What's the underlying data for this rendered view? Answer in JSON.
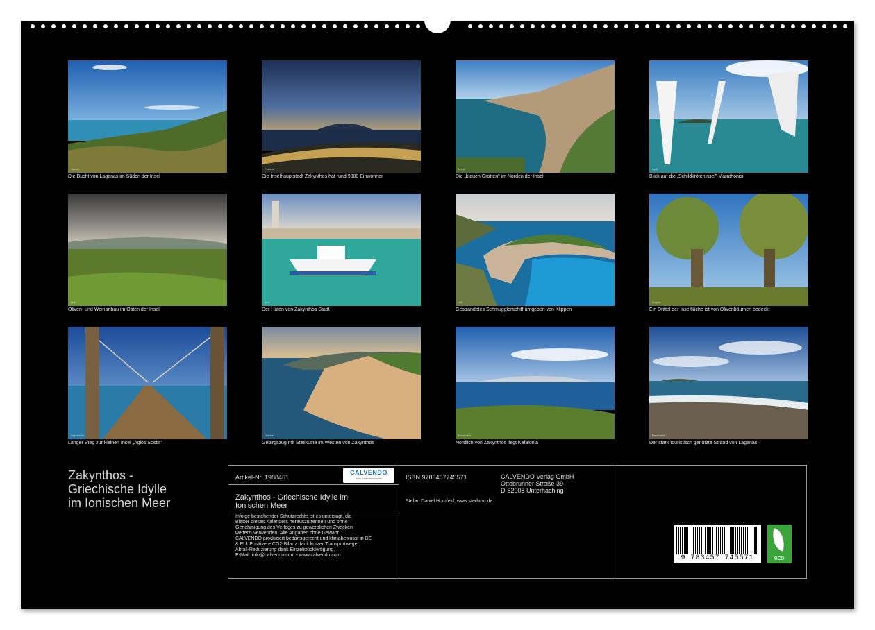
{
  "months": [
    "Januar",
    "Februar",
    "März",
    "April",
    "Mai",
    "Juni",
    "Juli",
    "August",
    "September",
    "Oktober",
    "November",
    "Dezember"
  ],
  "captions": [
    "Die Bucht von Laganas im Süden der Insel",
    "Die Inselhauptstadt Zakynthos hat rund 9800 Einwohner",
    "Die „blauen Grotten\" im Norden der Insel",
    "Blick auf die „Schildkröteninsel\" Marathonisi",
    "Oliven- und Weinanbau im Osten der Insel",
    "Der Hafen von Zakynthos Stadt",
    "Gestrandetes Schmugglerschiff umgeben von Klippen",
    "Ein Drittel der Inselfläche ist von Olivenbäumen bedeckt",
    "Langer Steg zur kleinen Insel „Agios Sostis\"",
    "Gebirgszug mit Steilküste im Westen von Zakynthos",
    "Nördlich von Zakynthos liegt Kefalonia",
    "Der stark touristisch genutzte Strand von Laganas"
  ],
  "title": {
    "line1": "Zakynthos -",
    "line2": "Griechische Idylle",
    "line3": "im Ionischen Meer"
  },
  "info": {
    "article": "Artikel-Nr. 1988461",
    "logo_text": "CALVENDO",
    "logo_sub": "Dein Kalendermacher",
    "product_title_1": "Zakynthos - Griechische Idylle im",
    "product_title_2": "Ionischen Meer",
    "legal": [
      "Infolge bestehender Schutzrechte ist es untersagt, die",
      "Blätter dieses Kalenders herauszutrennen und ohne",
      "Genehmigung des Verlages zu gewerblichen Zwecken",
      "weiterzuverwenden. Alle Angaben ohne Gewähr.",
      "CALVENDO produziert bedarfsgerecht und klimabewusst in DE",
      "& EU. Positivere CO2-Bilanz dank kurzer Transportwege,",
      "Abfall-Reduzierung dank Einzelstückfertigung.",
      "E-Mail: info@calvendo.com • www.calvendo.com"
    ],
    "isbn": "ISBN 9783457745571",
    "publisher_1": "CALVENDO Verlag GmbH",
    "publisher_2": "Ottobrunner Straße 39",
    "publisher_3": "D-82008 Unterhaching",
    "author": "Stefan Daniel Homfeld, www.stedaho.de",
    "barcode_number": "9 783457 745571",
    "eco_label": "eco"
  }
}
